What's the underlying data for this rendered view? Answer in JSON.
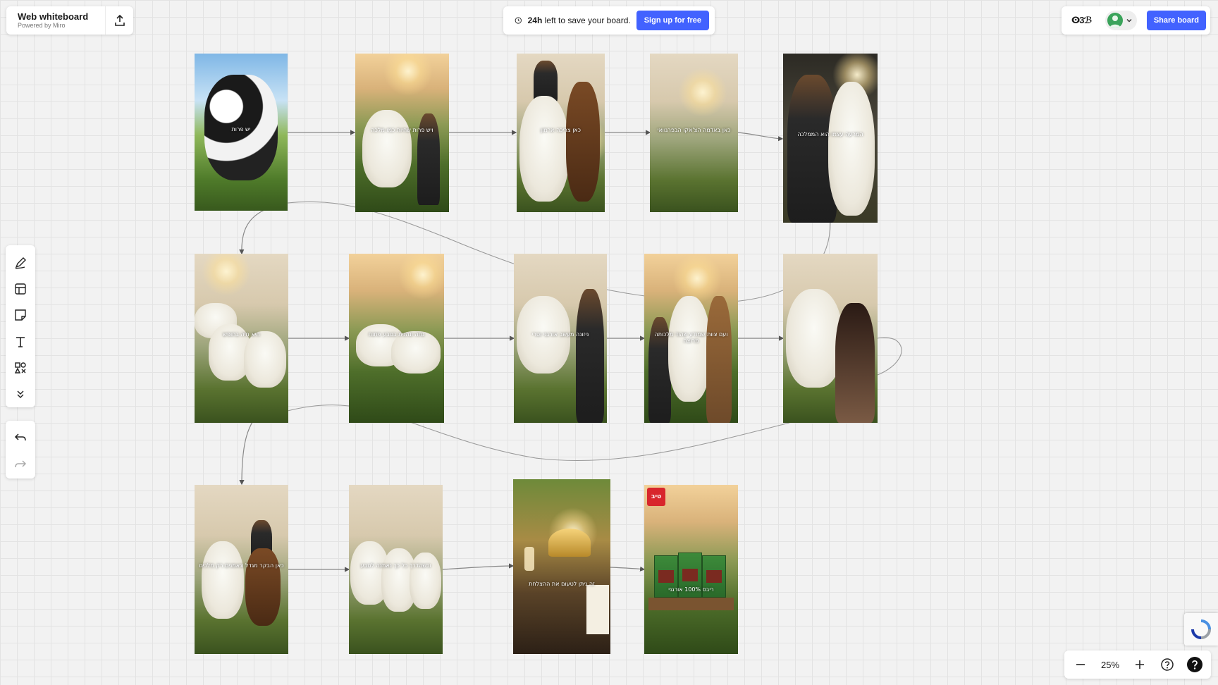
{
  "header": {
    "title": "Web whiteboard",
    "powered_by": "Powered by Miro",
    "export_icon": "upload-icon"
  },
  "banner": {
    "time_bold": "24h",
    "text": "left to save your board.",
    "signup_label": "Sign up for free",
    "clock_icon": "clock-icon"
  },
  "collab": {
    "reactions_label": "ⵙ3ℬ",
    "share_label": "Share board",
    "avatar_color": "#3aa35a"
  },
  "toolbar": {
    "tools": [
      "pen-icon",
      "template-icon",
      "sticky-note-icon",
      "text-icon",
      "shapes-icon",
      "more-tools-icon"
    ],
    "undo_icon": "undo-icon",
    "redo_icon": "redo-icon"
  },
  "zoom": {
    "value": "25%",
    "minus_icon": "minus-icon",
    "plus_icon": "plus-icon",
    "help_icon": "help-icon",
    "support_icon": "question-icon"
  },
  "frames": [
    {
      "caption": "יש פרות"
    },
    {
      "caption": "ויש פרות שחיות כמו מלכה"
    },
    {
      "caption": "כאן צריכה ארמון"
    },
    {
      "caption": "כאן באדמה הצ'אקו הבפרגוואי"
    },
    {
      "caption": "המרעה עצמו הוא הממלכה"
    },
    {
      "caption": "היא חיה בחופש"
    },
    {
      "caption": "נחה ונהנית בטבע פתוח"
    },
    {
      "caption": "ניזונה מעשב אורגני וטרי"
    },
    {
      "caption": "ועם צוות שמודע שהוד מלכותה מרוצה"
    },
    {
      "caption": ""
    },
    {
      "caption": "כאן הבקר מגדל ונאמנים רק מלכים"
    },
    {
      "caption": "וכשהדרך כל כך נאמנה לטבע"
    },
    {
      "caption": "זה ניתן לטעום את ההצלחת"
    },
    {
      "caption": "ריבס 100% אורגני"
    }
  ],
  "brand_label": "טיב",
  "colors": {
    "accent": "#4262ff",
    "canvas": "#f2f2f2"
  }
}
